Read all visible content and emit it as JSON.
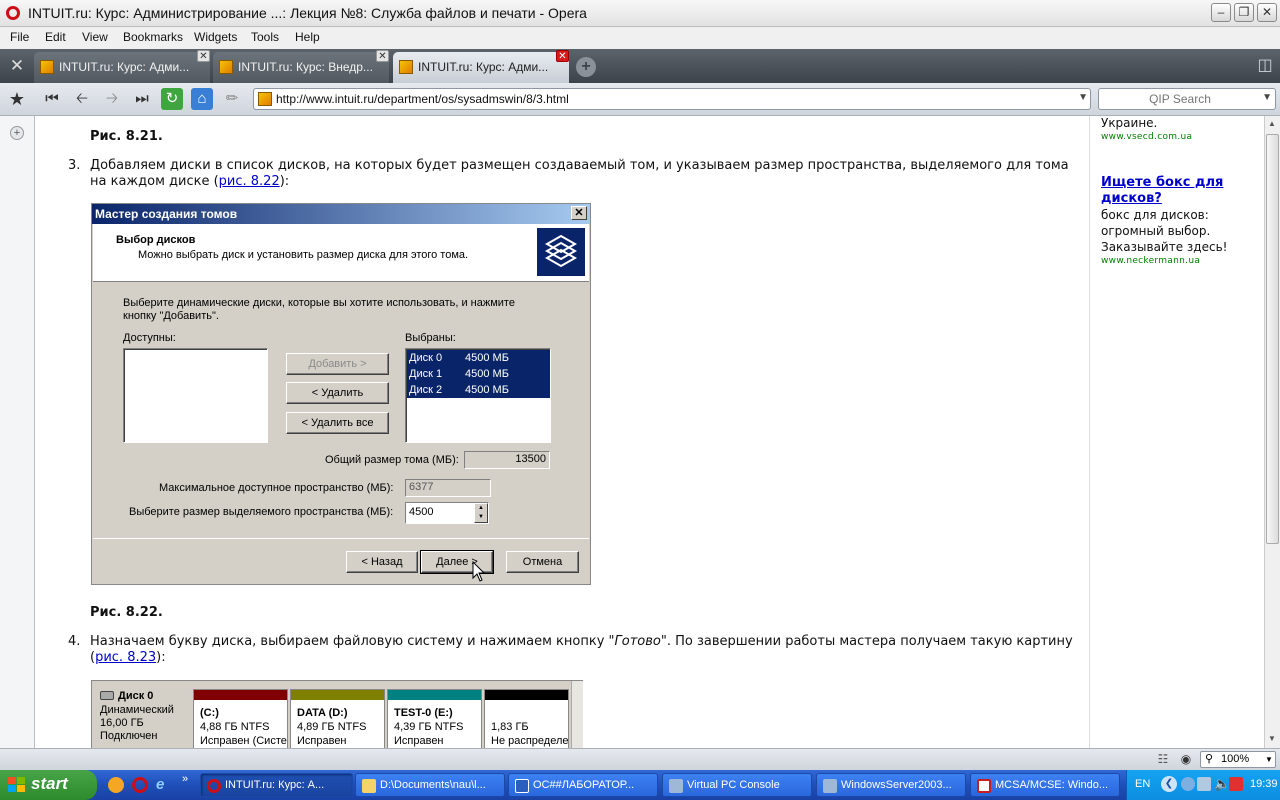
{
  "window": {
    "title": "INTUIT.ru: Курс: Администрирование ...: Лекция №8: Служба файлов и печати - Opera"
  },
  "menu": [
    "File",
    "Edit",
    "View",
    "Bookmarks",
    "Widgets",
    "Tools",
    "Help"
  ],
  "tabs": [
    {
      "label": "INTUIT.ru: Курс: Адми..."
    },
    {
      "label": "INTUIT.ru: Курс: Внедр..."
    },
    {
      "label": "INTUIT.ru: Курс: Адми..."
    }
  ],
  "address": {
    "url": "http://www.intuit.ru/department/os/sysadmswin/8/3.html"
  },
  "search": {
    "placeholder": "QIP Search"
  },
  "content": {
    "caption_top": "Рис. 8.21.",
    "item3": {
      "num": "3.",
      "text": "Добавляем диски в список дисков, на которых будет размещен создаваемый том, и указываем размер пространства, выделяемого для тома на каждом диске (",
      "link": "рис. 8.22",
      "tail": "):"
    },
    "caption_mid": "Рис. 8.22.",
    "item4": {
      "num": "4.",
      "text_a": "Назначаем букву диска, выбираем файловую систему и нажимаем кнопку \"",
      "text_em": "Готово",
      "text_b": "\". По завершении работы мастера получаем такую картину (",
      "link": "рис. 8.23",
      "tail": "):"
    }
  },
  "dialog": {
    "title": "Мастер создания томов",
    "heading": "Выбор дисков",
    "subheading": "Можно выбрать диск и установить размер диска для этого тома.",
    "instruction_1": "Выберите динамические диски, которые вы хотите использовать, и нажмите",
    "instruction_2": "кнопку \"Добавить\".",
    "available_label": "Доступны:",
    "selected_label": "Выбраны:",
    "selected": [
      {
        "disk": "Диск 0",
        "size": "4500 МБ"
      },
      {
        "disk": "Диск 1",
        "size": "4500 МБ"
      },
      {
        "disk": "Диск 2",
        "size": "4500 МБ"
      }
    ],
    "add_btn": "Добавить >",
    "remove_btn": "< Удалить",
    "remove_all_btn": "< Удалить все",
    "total_label": "Общий размер тома (МБ):",
    "total_value": "13500",
    "max_label": "Максимальное доступное пространство (МБ):",
    "max_value": "6377",
    "alloc_label": "Выберите размер выделяемого пространства (МБ):",
    "alloc_value": "4500",
    "back_btn": "< Назад",
    "next_btn": "Далее >",
    "cancel_btn": "Отмена"
  },
  "disk_view": {
    "disk_name": "Диск 0",
    "disk_type": "Динамический",
    "disk_size": "16,00 ГБ",
    "disk_status": "Подключен",
    "partitions": [
      {
        "name": "(C:)",
        "size": "4,88 ГБ NTFS",
        "status": "Исправен (Систе",
        "color": "#800000"
      },
      {
        "name": "DATA  (D:)",
        "size": "4,89 ГБ NTFS",
        "status": "Исправен",
        "color": "#808000"
      },
      {
        "name": "TEST-0  (E:)",
        "size": "4,39 ГБ NTFS",
        "status": "Исправен",
        "color": "#008080"
      },
      {
        "name": "",
        "size": "1,83 ГБ",
        "status": "Не распределе",
        "color": "#000000"
      }
    ]
  },
  "ads": {
    "frag": "Украине.",
    "url1": "www.vseсd.com.ua",
    "link": "Ищете бокс для дисков?",
    "line1": "бокс для дисков:",
    "line2": "огромный выбор.",
    "line3": "Заказывайте здесь!",
    "url2": "www.neckermann.ua"
  },
  "status": {
    "zoom": "100%"
  },
  "taskbar": {
    "start": "start",
    "tasks": [
      {
        "label": "INTUIT.ru: Курс: А...",
        "color": "#cc0f16"
      },
      {
        "label": "D:\\Documents\\nau\\l...",
        "color": "#f5d36b"
      },
      {
        "label": "ОС##ЛАБОРАТОР...",
        "color": "#2b5fbf"
      },
      {
        "label": "Virtual PC Console",
        "color": "#9fb8d8"
      },
      {
        "label": "WindowsServer2003...",
        "color": "#9fb8d8"
      },
      {
        "label": "MCSA/MCSE: Windo...",
        "color": "#c81e1e"
      }
    ],
    "lang": "EN",
    "clock": "19:39"
  }
}
